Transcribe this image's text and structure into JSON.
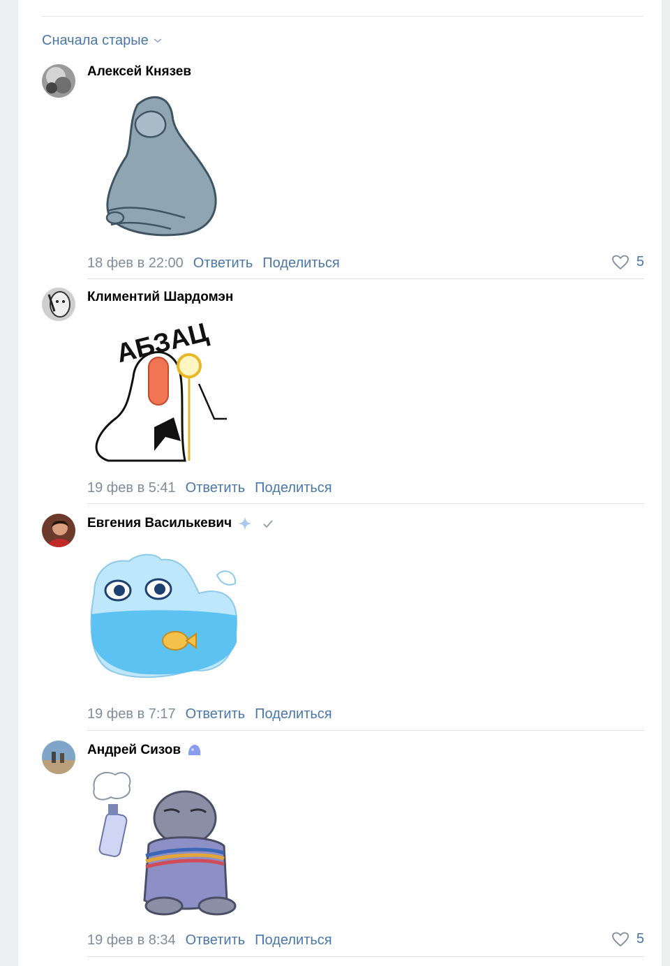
{
  "sort": {
    "label": "Сначала старые"
  },
  "actions": {
    "reply": "Ответить",
    "share": "Поделиться"
  },
  "comments": [
    {
      "author": "Алексей Князев",
      "date": "18 фев в 22:00",
      "likes": "5",
      "sticker": "seal-facepalm"
    },
    {
      "author": "Климентий Шардомэн",
      "date": "19 фев в 5:41",
      "likes": "",
      "sticker": "abzac-bird",
      "sticker_text": "АБЗАЦ"
    },
    {
      "author": "Евгения Василькевич",
      "date": "19 фев в 7:17",
      "likes": "",
      "sticker": "water-cat",
      "badges": [
        "sparkle-icon",
        "verified-check-icon"
      ]
    },
    {
      "author": "Андрей Сизов",
      "date": "19 фев в 8:34",
      "likes": "5",
      "sticker": "seal-spray",
      "badges": [
        "blob-badge-icon"
      ]
    }
  ],
  "colors": {
    "link": "#4a76a8",
    "muted": "#818c99",
    "separator": "#dce1e6"
  }
}
